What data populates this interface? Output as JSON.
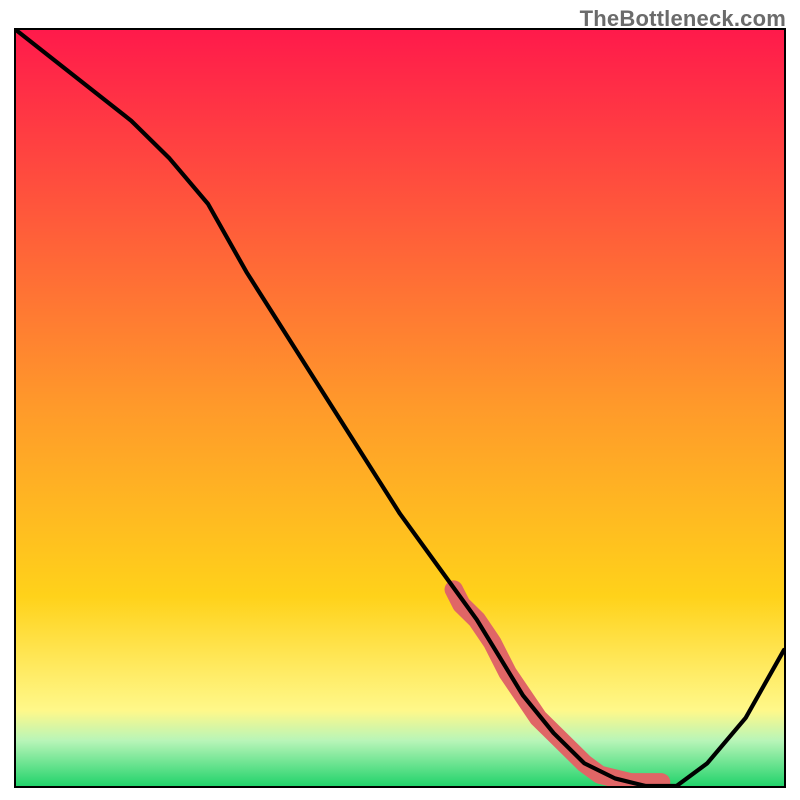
{
  "watermark": "TheBottleneck.com",
  "colors": {
    "top": "#ff1a4b",
    "mid": "#ffd21a",
    "band_yellow": "#fff88a",
    "band_light_green": "#b8f5b8",
    "bottom_green": "#22d36b",
    "curve": "#000000",
    "marker": "#e06666",
    "border": "#000000"
  },
  "chart_data": {
    "type": "line",
    "title": "",
    "xlabel": "",
    "ylabel": "",
    "xlim": [
      0,
      100
    ],
    "ylim": [
      0,
      100
    ],
    "grid": false,
    "legend": false,
    "series": [
      {
        "name": "curve",
        "x": [
          0,
          5,
          10,
          15,
          20,
          25,
          30,
          35,
          40,
          45,
          50,
          55,
          60,
          63,
          66,
          70,
          74,
          78,
          82,
          86,
          90,
          95,
          100
        ],
        "y": [
          100,
          96,
          92,
          88,
          83,
          77,
          68,
          60,
          52,
          44,
          36,
          29,
          22,
          17,
          12,
          7,
          3,
          1,
          0,
          0,
          3,
          9,
          18
        ]
      }
    ],
    "markers": {
      "name": "highlighted-segment",
      "comment": "thick salmon markers along curve near the minimum",
      "x": [
        57,
        58,
        60,
        62,
        64,
        66,
        68,
        70,
        72,
        74,
        76,
        78,
        80,
        82,
        83,
        84
      ],
      "y": [
        26,
        24,
        22,
        19,
        15,
        12,
        9,
        7,
        5,
        3,
        1.5,
        1,
        0.5,
        0.5,
        0.5,
        0.5
      ]
    },
    "gradient_stops": [
      {
        "offset": 0.0,
        "color": "#ff1a4b"
      },
      {
        "offset": 0.5,
        "color": "#ff9a2a"
      },
      {
        "offset": 0.75,
        "color": "#ffd21a"
      },
      {
        "offset": 0.9,
        "color": "#fff88a"
      },
      {
        "offset": 0.94,
        "color": "#b8f5b8"
      },
      {
        "offset": 1.0,
        "color": "#22d36b"
      }
    ]
  }
}
